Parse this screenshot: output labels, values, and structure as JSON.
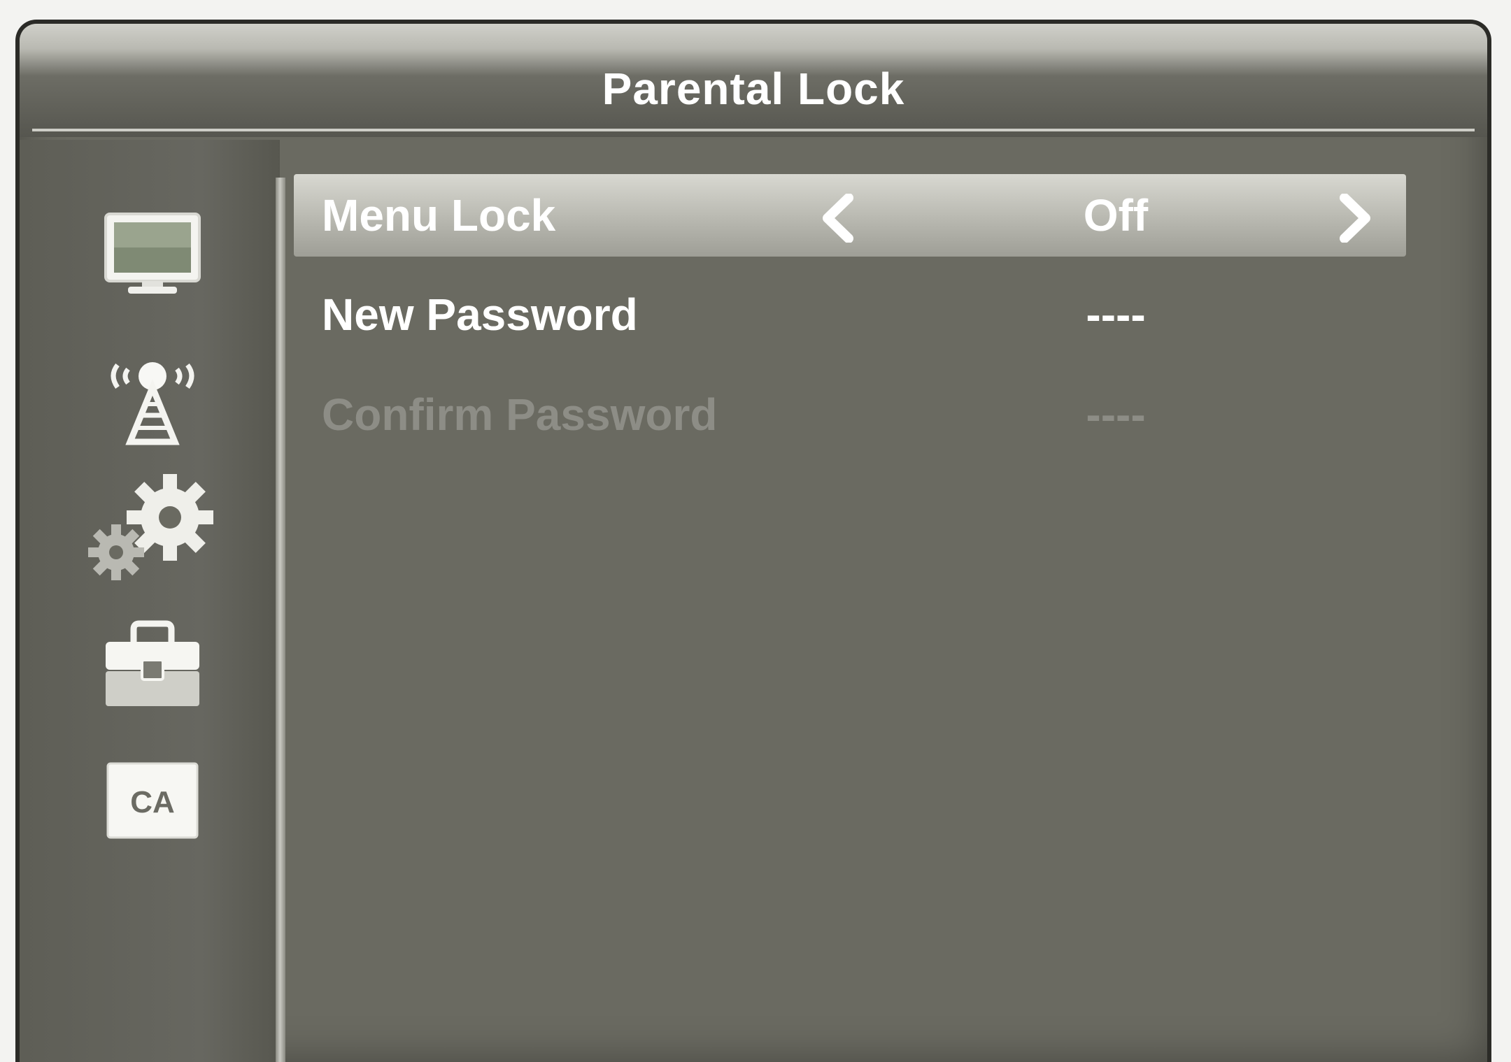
{
  "header": {
    "title": "Parental Lock"
  },
  "sidebar": {
    "items": [
      {
        "icon": "monitor-icon"
      },
      {
        "icon": "antenna-icon"
      },
      {
        "icon": "gears-icon"
      },
      {
        "icon": "toolbox-icon"
      },
      {
        "icon": "ca-card-icon",
        "label": "CA"
      }
    ]
  },
  "menu": {
    "rows": [
      {
        "label": "Menu Lock",
        "value": "Off",
        "selected": true
      },
      {
        "label": "New Password",
        "value": "----"
      },
      {
        "label": "Confirm Password",
        "value": "----",
        "disabled": true
      }
    ]
  },
  "colors": {
    "panel": "#6a6a61",
    "highlight": "#c8c8c0",
    "text": "#ffffff",
    "disabled_text": "#8d8d86"
  }
}
